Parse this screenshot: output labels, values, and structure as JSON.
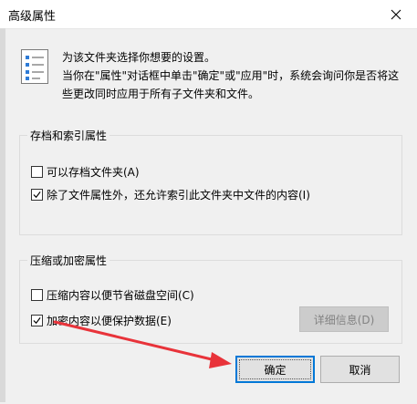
{
  "window": {
    "title": "高级属性"
  },
  "description": {
    "line1": "为该文件夹选择你想要的设置。",
    "line2": "当你在\"属性\"对话框中单击\"确定\"或\"应用\"时，系统会询问你是否将这些更改同时应用于所有子文件夹和文件。"
  },
  "archive_group": {
    "title": "存档和索引属性",
    "items": [
      {
        "label": "可以存档文件夹(A)",
        "checked": false
      },
      {
        "label": "除了文件属性外，还允许索引此文件夹中文件的内容(I)",
        "checked": true
      }
    ]
  },
  "compress_group": {
    "title": "压缩或加密属性",
    "items": [
      {
        "label": "压缩内容以便节省磁盘空间(C)",
        "checked": false
      },
      {
        "label": "加密内容以便保护数据(E)",
        "checked": true
      }
    ],
    "details_button": "详细信息(D)"
  },
  "buttons": {
    "ok": "确定",
    "cancel": "取消"
  },
  "colors": {
    "accent": "#0078d7",
    "annotation_arrow": "#e8333a"
  }
}
